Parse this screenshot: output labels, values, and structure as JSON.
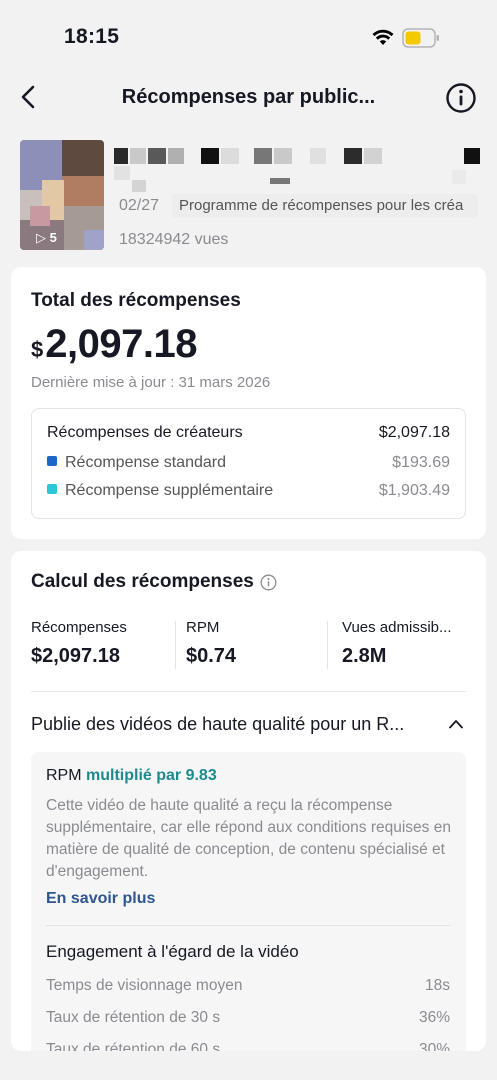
{
  "status_bar": {
    "time": "18:15"
  },
  "nav": {
    "title": "Récompenses par public..."
  },
  "video": {
    "date": "02/27",
    "program_tag": "Programme de récompenses pour les créa",
    "views": "18324942 vues"
  },
  "total": {
    "heading": "Total des récompenses",
    "currency": "$",
    "amount": "2,097.18",
    "updated": "Dernière mise à jour : 31 mars 2026",
    "breakdown": {
      "creator_label": "Récompenses de créateurs",
      "creator_value": "$2,097.18",
      "standard_label": "Récompense standard",
      "standard_value": "$193.69",
      "standard_color": "#1a66c9",
      "extra_label": "Récompense supplémentaire",
      "extra_value": "$1,903.49",
      "extra_color": "#2bc7d9"
    }
  },
  "calc": {
    "heading": "Calcul des récompenses",
    "metrics": [
      {
        "label": "Récompenses",
        "value": "$2,097.18"
      },
      {
        "label": "RPM",
        "value": "$0.74"
      },
      {
        "label": "Vues admissib...",
        "value": "2.8M"
      }
    ],
    "quality_title": "Publie des vidéos de haute qualité pour un R...",
    "rpm_prefix": "RPM",
    "rpm_multiplier": "multiplié par 9.83",
    "rpm_description": "Cette vidéo de haute qualité a reçu la récompense supplémentaire, car elle répond aux conditions requises en matière de qualité de conception, de contenu spécialisé et d'engagement.",
    "learn_more": "En savoir plus",
    "engagement_title": "Engagement à l'égard de la vidéo",
    "engagement_rows": [
      {
        "label": "Temps de visionnage moyen",
        "value": "18s"
      },
      {
        "label": "Taux de rétention de 30 s",
        "value": "36%"
      },
      {
        "label": "Taux de rétention de 60 s",
        "value": "30%"
      }
    ]
  }
}
